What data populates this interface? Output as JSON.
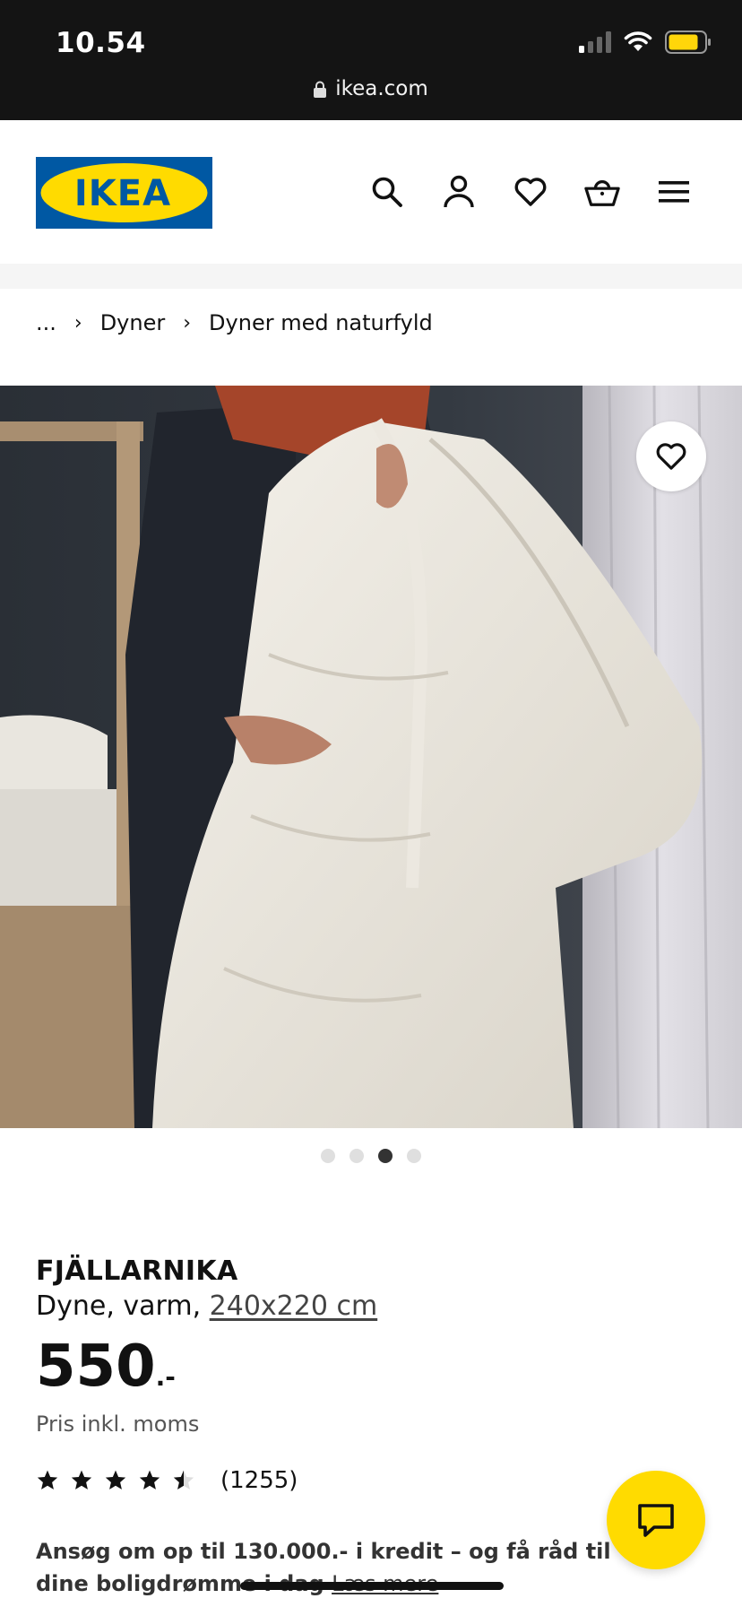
{
  "status_bar": {
    "time": "10.54",
    "url": "ikea.com"
  },
  "header": {
    "logo_text": "IKEA"
  },
  "breadcrumb": {
    "ellipsis": "...",
    "items": [
      "Dyner",
      "Dyner med naturfyld"
    ]
  },
  "carousel": {
    "active_index": 2,
    "count": 4
  },
  "product": {
    "name": "FJÄLLARNIKA",
    "description_prefix": "Dyne, varm, ",
    "size": "240x220 cm",
    "price": "550",
    "price_suffix": ".-",
    "price_note": "Pris inkl. moms",
    "rating_stars": 4.5,
    "review_count": "(1255)"
  },
  "credit": {
    "text": "Ansøg om op til 130.000.- i kredit – og få råd til dine boligdrømme i dag",
    "link": "Læs mere"
  },
  "colors": {
    "ikea_blue": "#0058a3",
    "ikea_yellow": "#ffdb00",
    "status_bar": "#141414"
  }
}
